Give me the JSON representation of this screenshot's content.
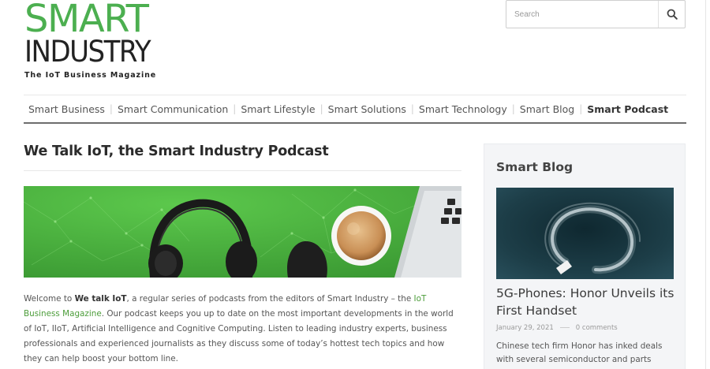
{
  "logo": {
    "line1": "SMART",
    "line2": "INDUSTRY",
    "tagline": "The IoT Business Magazine"
  },
  "search": {
    "placeholder": "Search"
  },
  "nav": {
    "items": [
      {
        "label": "Smart Business"
      },
      {
        "label": "Smart Communication"
      },
      {
        "label": "Smart Lifestyle"
      },
      {
        "label": "Smart Solutions"
      },
      {
        "label": "Smart Technology"
      },
      {
        "label": "Smart Blog"
      },
      {
        "label": "Smart Podcast",
        "active": true
      }
    ]
  },
  "article": {
    "title": "We Talk IoT, the Smart Industry Podcast",
    "intro_1": "Welcome to ",
    "intro_bold": "We talk IoT",
    "intro_2": ", a regular series of podcasts from the editors of Smart Industry – the ",
    "intro_link": "IoT Business Magazine",
    "intro_3": ". Our podcast keeps you up to date on the most important developments in the world of IoT, IIoT, Artificial Intelligence and Cognitive Computing. Listen to leading industry experts, business professionals and experienced journalists as they discuss some of today’s hottest tech topics and how they can help boost your bottom line."
  },
  "sidebar": {
    "heading": "Smart Blog",
    "post_title": "5G-Phones: Honor Unveils its First Handset",
    "post_date": "January 29, 2021",
    "post_comments": "0 comments",
    "post_excerpt": "Chinese tech firm Honor has inked deals with several semiconductor and parts suppliers,"
  },
  "colors": {
    "brand_green": "#4caf50",
    "link_green": "#4c9d3a",
    "hero_green": "#4aac3e",
    "nav_rule": "#6d6d6d"
  },
  "icons": {
    "search": "search-icon"
  }
}
